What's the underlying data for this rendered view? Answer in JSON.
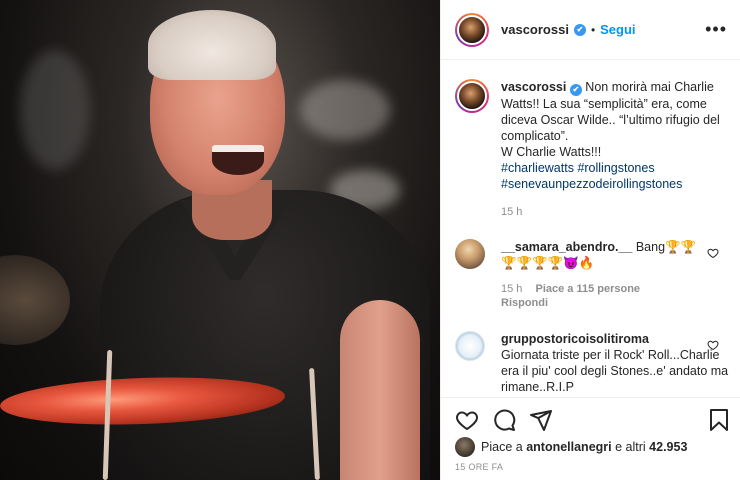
{
  "post": {
    "username": "vascorossi",
    "verified_mark": "✔",
    "dot": "•",
    "follow_label": "Segui",
    "more_label": "•••"
  },
  "caption": {
    "username": "vascorossi",
    "text_line1": "Non morirà mai Charlie Watts!! La sua “semplicità” era, come diceva Oscar Wilde.. “l’ultimo rifugio del complicato”.",
    "text_line2": "W Charlie Watts!!!",
    "hashtags": [
      "#charliewatts",
      "#rollingstones",
      "#senevaunpezzodeirollingstones"
    ],
    "time": "15 h"
  },
  "comments": [
    {
      "username": "__samara_abendro.__",
      "text": "Bang🏆🏆",
      "text2": "🏆🏆🏆🏆😈🔥",
      "time": "15 h",
      "likes": "Piace a 115 persone",
      "reply": "Rispondi"
    },
    {
      "username": "gruppostoricoisolitiroma",
      "text": "Giornata triste per il Rock' Roll...Charlie era il piu' cool degli Stones..e' andato ma rimane..R.I.P"
    }
  ],
  "actions": {
    "liked_by_prefix": "Piace a",
    "liked_by_user": "antonellanegri",
    "liked_by_suffix": "e altri",
    "liked_by_count": "42.953",
    "time_ago": "15 ORE FA"
  },
  "icons": [
    "heart-icon",
    "comment-icon",
    "share-icon",
    "bookmark-icon",
    "more-icon",
    "verified-badge-icon"
  ],
  "colors": {
    "accent_blue": "#0095f6",
    "verified_blue": "#3897f0",
    "hashtag": "#00376b",
    "muted": "#8e8e8e"
  }
}
